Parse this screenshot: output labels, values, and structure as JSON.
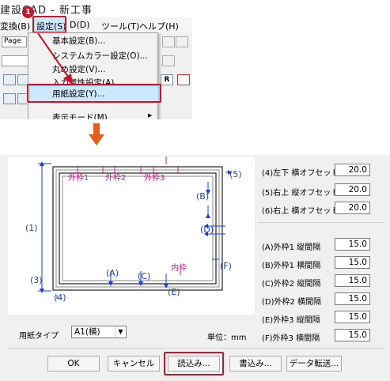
{
  "app": {
    "title": "建設CAD - 新工事"
  },
  "menu": {
    "items": [
      {
        "label": "変換(B)"
      },
      {
        "label": "設定(S)"
      },
      {
        "label": "D(D)"
      },
      {
        "label": "ツール(T)"
      },
      {
        "label": "ヘルプ(H)"
      }
    ],
    "page_label": "Page"
  },
  "steps": {
    "step1": "1"
  },
  "settings_menu": {
    "items": [
      {
        "label": "基本設定(B)..."
      },
      {
        "label": "システムカラー設定(O)..."
      },
      {
        "label": "丸め設定(V)..."
      },
      {
        "label": "入力属性設定(A)..."
      },
      {
        "label": "用紙設定(Y)..."
      },
      {
        "label": "表示モード(M)"
      }
    ]
  },
  "preview": {
    "label_frame1": "外枠1",
    "label_frame2": "外枠2",
    "label_frame3": "外枠3",
    "label_inner": "内枠",
    "markers": {
      "1": "(1)",
      "3": "(3)",
      "4": "(4)",
      "5": "(5)",
      "A": "(A)",
      "B": "(B)",
      "C": "(C)",
      "D": "(D)",
      "E": "(E)",
      "F": "(F)"
    }
  },
  "offsets": [
    {
      "label": "(4)左下 横オフセット",
      "value": "20.0"
    },
    {
      "label": "(5)右上 縦オフセット",
      "value": "20.0"
    },
    {
      "label": "(6)右上 横オフセット",
      "value": "20.0"
    }
  ],
  "spacings": [
    {
      "label": "(A)外枠1 縦間隔",
      "value": "15.0"
    },
    {
      "label": "(B)外枠1 横間隔",
      "value": "15.0"
    },
    {
      "label": "(C)外枠2 縦間隔",
      "value": "15.0"
    },
    {
      "label": "(D)外枠2 横間隔",
      "value": "15.0"
    },
    {
      "label": "(E)外枠3 縦間隔",
      "value": "15.0"
    },
    {
      "label": "(F)外枠3 横間隔",
      "value": "15.0"
    }
  ],
  "paper_type": {
    "label": "用紙タイプ",
    "value": "A1(横)"
  },
  "unit": "単位：mm",
  "buttons": {
    "ok": "OK",
    "cancel": "キャンセル",
    "load": "読込み...",
    "save": "書込み...",
    "transfer": "データ転送..."
  },
  "colors": {
    "highlight": "#c0182f",
    "accent_arrow": "#e0601a",
    "diagram_magenta": "#e0138c",
    "diagram_blue": "#1a3fd6"
  }
}
